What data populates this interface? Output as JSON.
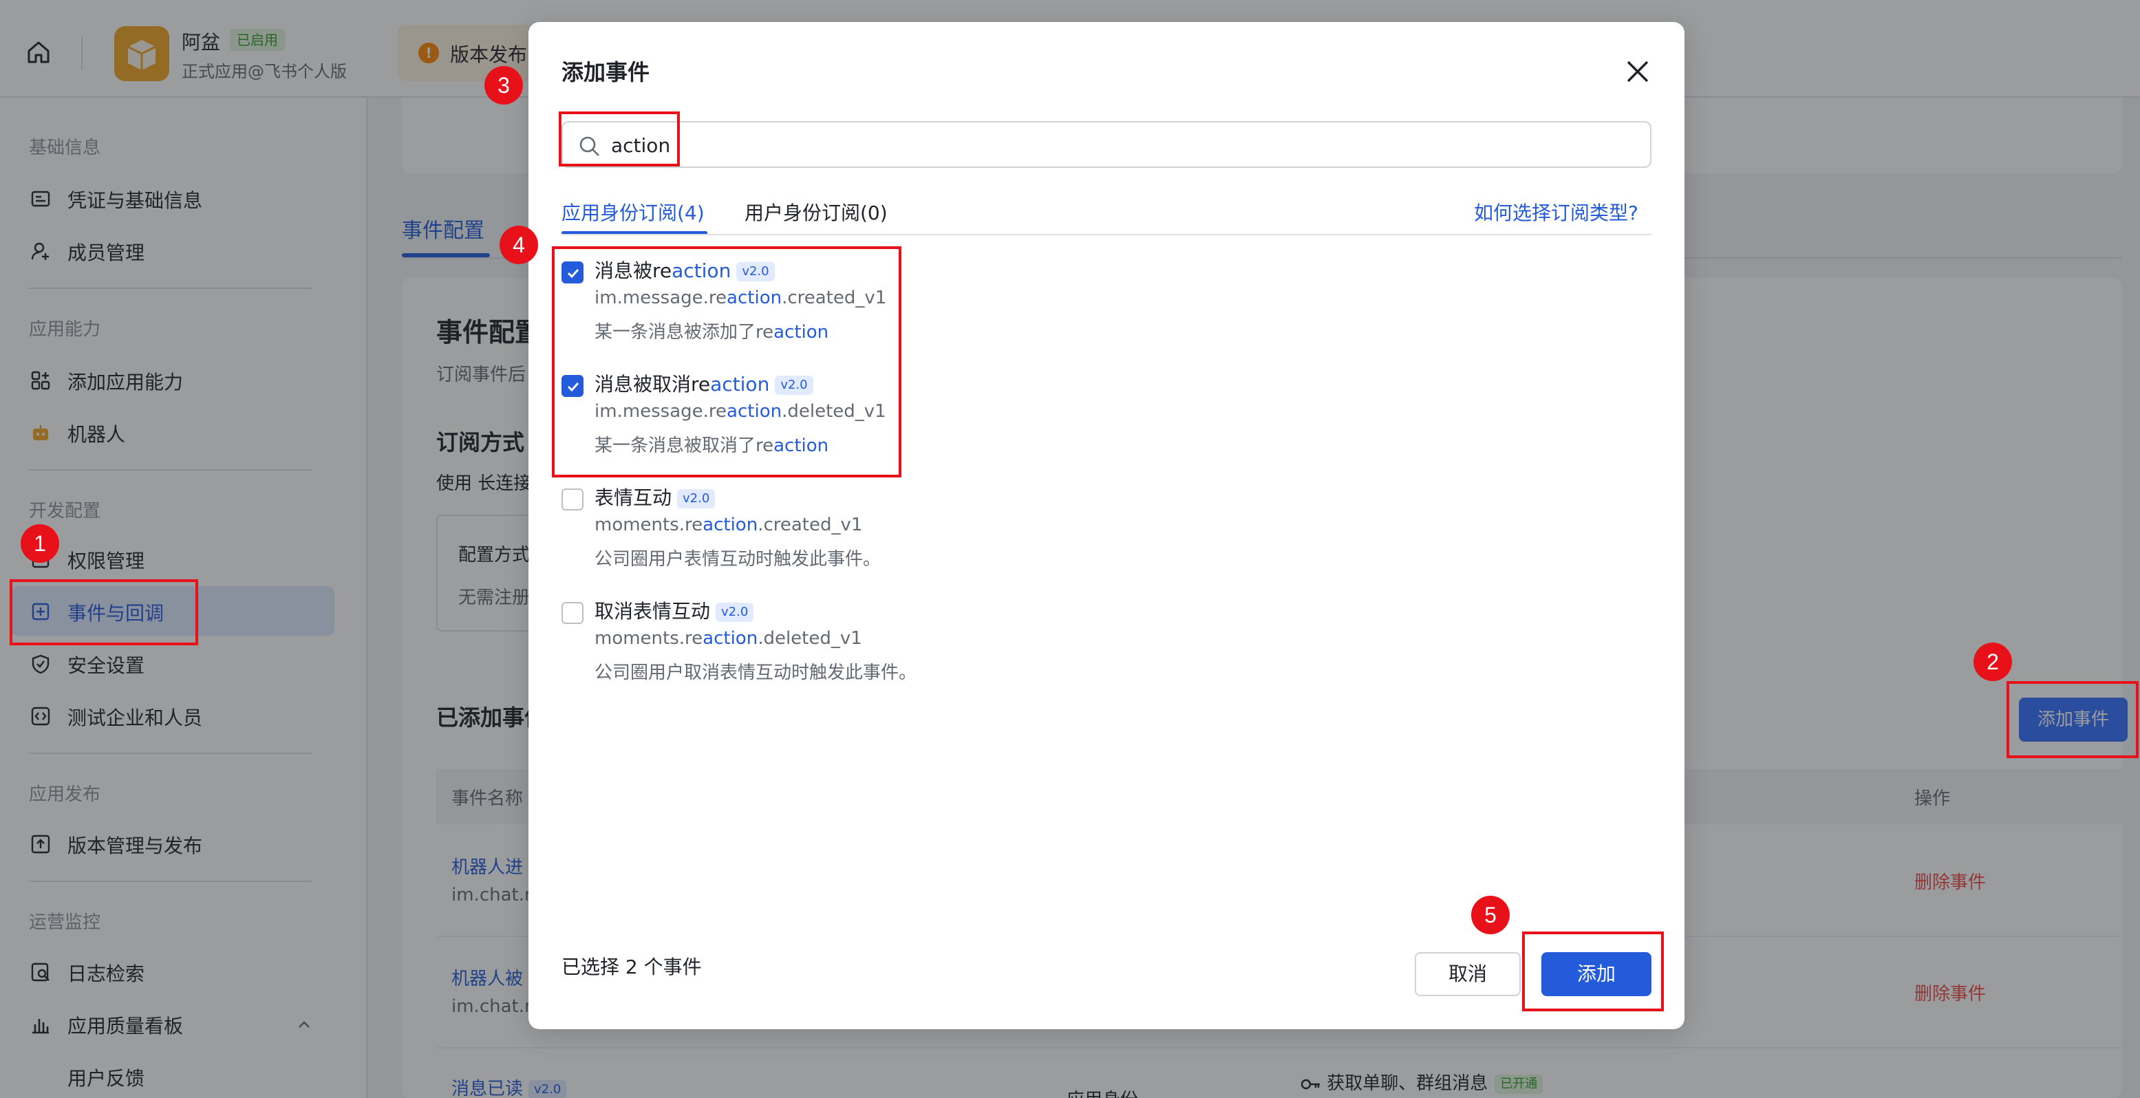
{
  "header": {
    "app_name": "阿盆",
    "status_badge": "已启用",
    "app_subtitle": "正式应用@飞书个人版",
    "release_notice": "版本发布"
  },
  "sidebar": {
    "sections": [
      {
        "title": "基础信息",
        "items": [
          "凭证与基础信息",
          "成员管理"
        ]
      },
      {
        "title": "应用能力",
        "items": [
          "添加应用能力",
          "机器人"
        ]
      },
      {
        "title": "开发配置",
        "items": [
          "权限管理",
          "事件与回调",
          "安全设置",
          "测试企业和人员"
        ]
      },
      {
        "title": "应用发布",
        "items": [
          "版本管理与发布"
        ]
      },
      {
        "title": "运营监控",
        "items": [
          "日志检索",
          "应用质量看板",
          "用户反馈"
        ]
      }
    ],
    "active_item": "事件与回调"
  },
  "main": {
    "tab": "事件配置",
    "title": "事件配置",
    "desc": "订阅事件后",
    "subscribe_title": "订阅方式",
    "subscribe_desc": "使用 长连接",
    "config_mode": "配置方式",
    "config_note": "无需注册",
    "added_title": "已添加事件",
    "add_event_button": "添加事件",
    "table": {
      "col_name": "事件名称",
      "col_op": "操作",
      "rows": [
        {
          "name": "机器人进",
          "id": "im.chat.r",
          "op": "删除事件"
        },
        {
          "name": "机器人被",
          "id": "im.chat.r",
          "op": "删除事件"
        },
        {
          "name": "消息已读",
          "badge": "v2.0",
          "perm": "应用身份",
          "scope": "获取单聊、群组消息",
          "scope_badge": "已开通"
        }
      ]
    }
  },
  "modal": {
    "title": "添加事件",
    "search": {
      "value": "action",
      "placeholder": ""
    },
    "tabs": {
      "app": "应用身份订阅(4)",
      "user": "用户身份订阅(0)"
    },
    "help_link": "如何选择订阅类型?",
    "events": [
      {
        "name_pre": "消息被re",
        "name_hl": "action",
        "badge": "v2.0",
        "key_pre": "im.message.re",
        "key_hl": "action",
        "key_post": ".created_v1",
        "desc_pre": "某一条消息被添加了re",
        "desc_hl": "action",
        "desc_post": "",
        "checked": true
      },
      {
        "name_pre": "消息被取消re",
        "name_hl": "action",
        "badge": "v2.0",
        "key_pre": "im.message.re",
        "key_hl": "action",
        "key_post": ".deleted_v1",
        "desc_pre": "某一条消息被取消了re",
        "desc_hl": "action",
        "desc_post": "",
        "checked": true
      },
      {
        "name_pre": "表情互动",
        "name_hl": "",
        "badge": "v2.0",
        "key_pre": "moments.re",
        "key_hl": "action",
        "key_post": ".created_v1",
        "desc_pre": "公司圈用户表情互动时触发此事件。",
        "desc_hl": "",
        "desc_post": "",
        "checked": false
      },
      {
        "name_pre": "取消表情互动",
        "name_hl": "",
        "badge": "v2.0",
        "key_pre": "moments.re",
        "key_hl": "action",
        "key_post": ".deleted_v1",
        "desc_pre": "公司圈用户取消表情互动时触发此事件。",
        "desc_hl": "",
        "desc_post": "",
        "checked": false
      }
    ],
    "selected_count": "已选择 2 个事件",
    "cancel_button": "取消",
    "add_button": "添加"
  },
  "annotations": [
    "1",
    "2",
    "3",
    "4",
    "5"
  ],
  "colors": {
    "primary": "#245bdb",
    "accent_button": "#3370ff",
    "danger": "#f54a45",
    "annotation_red": "#e8111a",
    "app_icon": "#f5a623"
  }
}
